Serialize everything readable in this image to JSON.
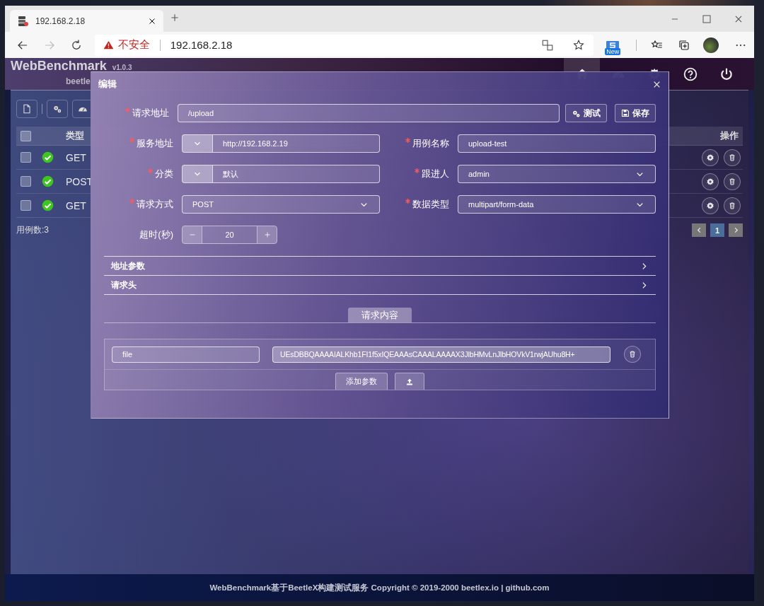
{
  "browser": {
    "tab_title": "192.168.2.18",
    "security_label": "不安全",
    "address": "192.168.2.18",
    "extension_badge": "New"
  },
  "app": {
    "title": "WebBenchmark",
    "version": "v1.0.3",
    "subtitle": "beetle",
    "nav": [
      {
        "kind": "home",
        "selected": true
      },
      {
        "kind": "dashboard",
        "selected": false
      },
      {
        "kind": "settings",
        "selected": false
      },
      {
        "kind": "help",
        "selected": false
      },
      {
        "kind": "power",
        "selected": false
      }
    ]
  },
  "table": {
    "columns": {
      "type": "类型",
      "actions": "操作"
    },
    "header_checked": false,
    "rows": [
      {
        "checked": false,
        "method": "GET"
      },
      {
        "checked": false,
        "method": "POST"
      },
      {
        "checked": false,
        "method": "GET"
      }
    ],
    "count": "用例数:3",
    "pages": [
      {
        "label": "1",
        "selected": true
      }
    ]
  },
  "dialog": {
    "title": "编辑",
    "url": {
      "label": "请求地址",
      "required": true,
      "value": "/upload"
    },
    "buttons": [
      {
        "kind": "test",
        "label": "测试"
      },
      {
        "kind": "save",
        "label": "保存"
      }
    ],
    "fields": [
      {
        "label": "服务地址",
        "required": true,
        "kind": "combo",
        "value": "http://192.168.2.19"
      },
      {
        "label": "用例名称",
        "required": true,
        "kind": "text",
        "value": "upload-test"
      },
      {
        "label": "分类",
        "required": true,
        "kind": "combo",
        "value": "默认"
      },
      {
        "label": "跟进人",
        "required": true,
        "kind": "select",
        "value": "admin"
      },
      {
        "label": "请求方式",
        "required": true,
        "kind": "select",
        "value": "POST"
      },
      {
        "label": "数据类型",
        "required": true,
        "kind": "select",
        "value": "multipart/form-data"
      },
      {
        "label": "超时(秒)",
        "required": false,
        "kind": "stepper",
        "value": "20"
      }
    ],
    "sections": [
      {
        "label": "地址参数",
        "expanded": false
      },
      {
        "label": "请求头",
        "expanded": false
      }
    ],
    "body_tab": {
      "label": "请求内容",
      "selected": true
    },
    "params": [
      {
        "name": "file",
        "value": "UEsDBBQAAAAIALKhb1FI1f5xIQEAAAsCAAALAAAAX3JlbHMvLnJlbHOVkV1rwjAUhu8H+"
      }
    ],
    "add_param": "添加参数"
  },
  "footer": "WebBenchmark基于BeetleX构建测试服务 Copyright © 2019-2000 beetlex.io | github.com"
}
